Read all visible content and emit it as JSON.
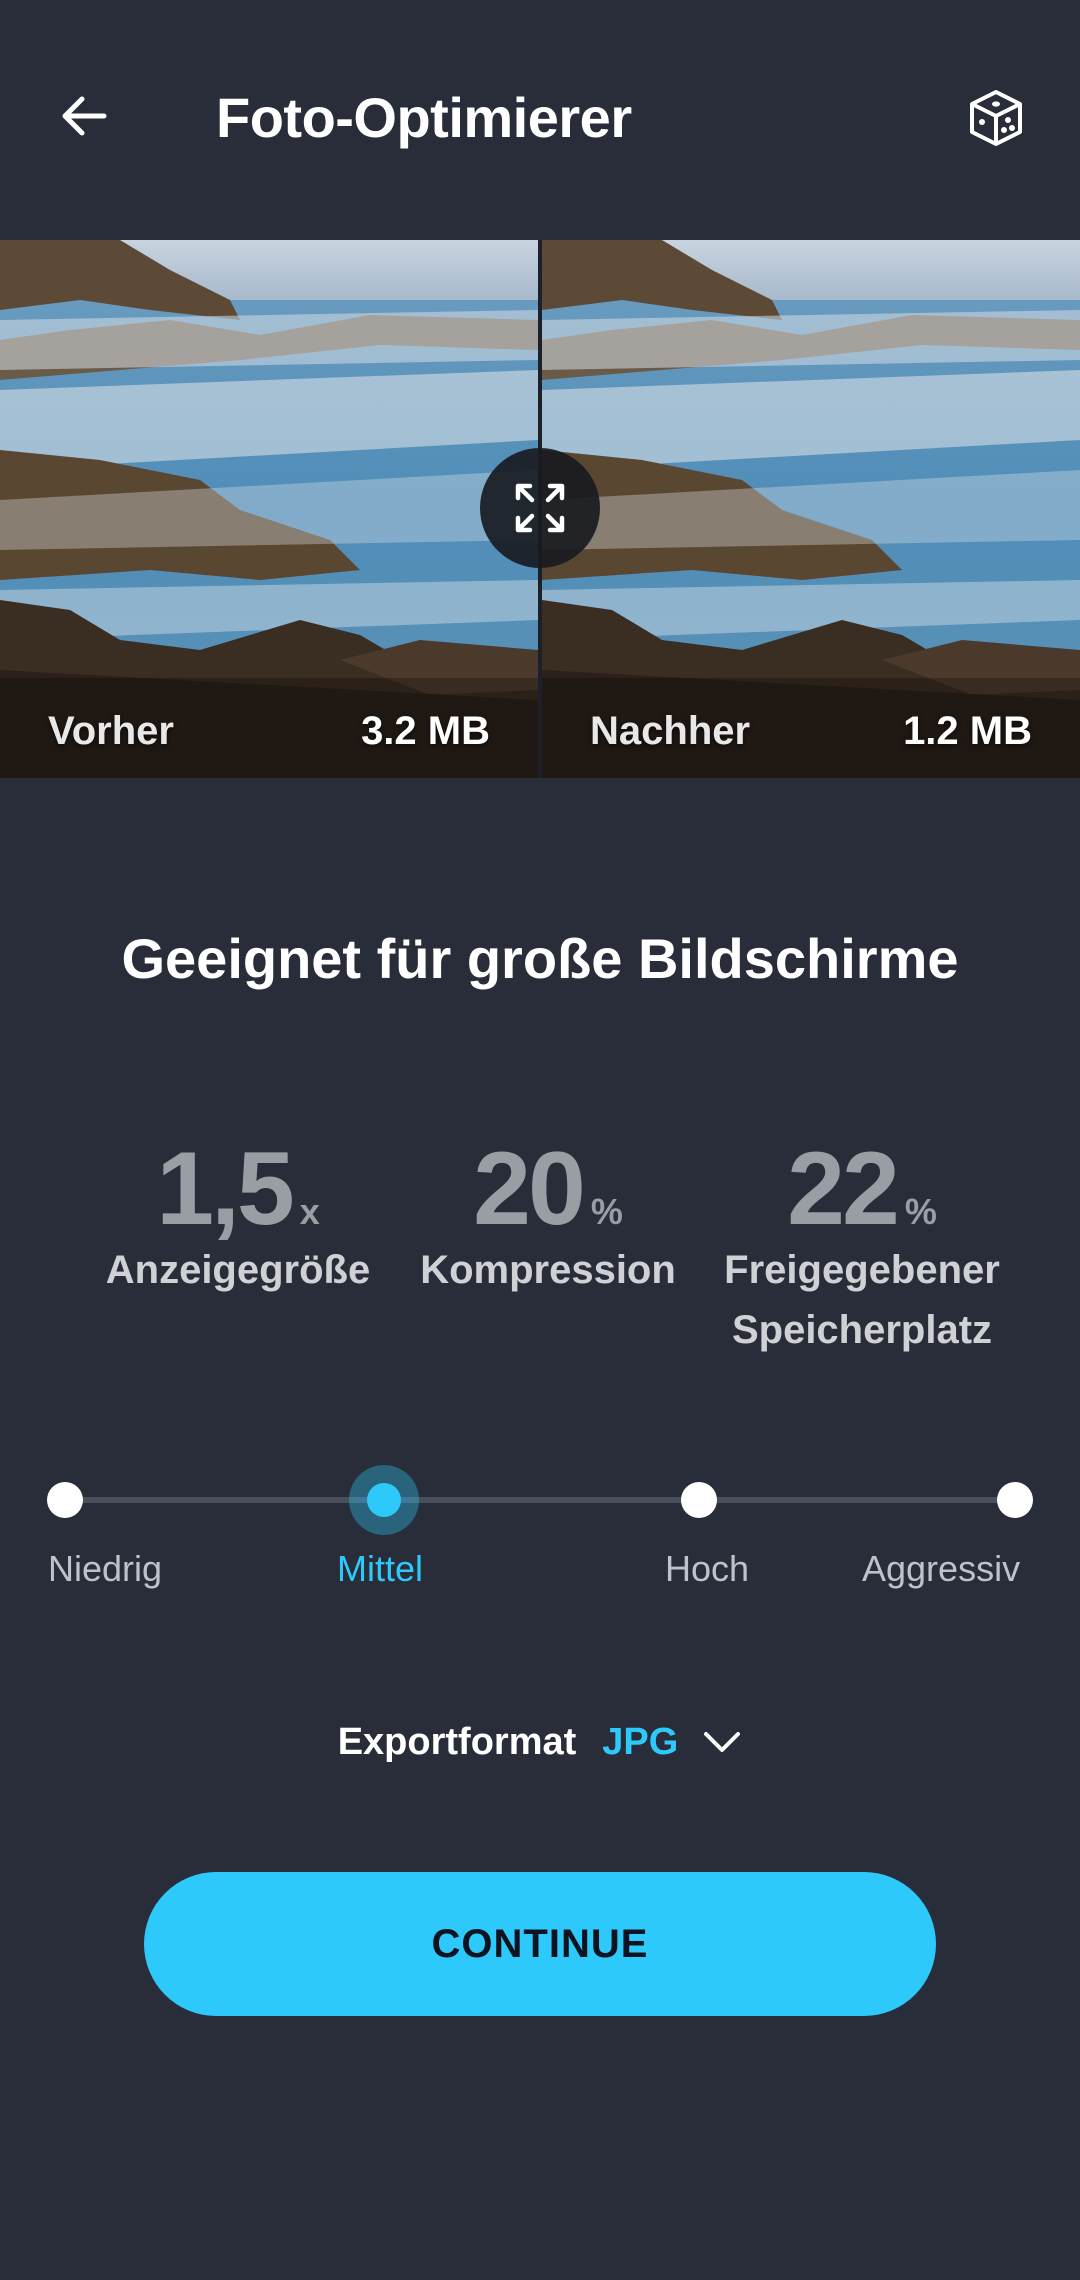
{
  "header": {
    "title": "Foto-Optimierer",
    "back_icon": "arrow-left-icon",
    "dice_icon": "dice-icon"
  },
  "compare": {
    "before": {
      "label": "Vorher",
      "size": "3.2 MB"
    },
    "after": {
      "label": "Nachher",
      "size": "1.2 MB"
    },
    "expand_icon": "expand-icon"
  },
  "headline": "Geeignet für große Bildschirme",
  "stats": [
    {
      "value": "1,5",
      "unit": "x",
      "label": "Anzeigegröße"
    },
    {
      "value": "20",
      "unit": "%",
      "label": "Kompression"
    },
    {
      "value": "22",
      "unit": "%",
      "label_line1": "Freigegebener",
      "label_line2": "Speicherplatz"
    }
  ],
  "slider": {
    "levels": [
      "Niedrig",
      "Mittel",
      "Hoch",
      "Aggressiv"
    ],
    "selected": "Mittel"
  },
  "export": {
    "label": "Exportformat",
    "value": "JPG",
    "chevron_icon": "chevron-down-icon"
  },
  "continue_label": "CONTINUE",
  "colors": {
    "background": "#282d39",
    "accent": "#2ec9fb"
  }
}
